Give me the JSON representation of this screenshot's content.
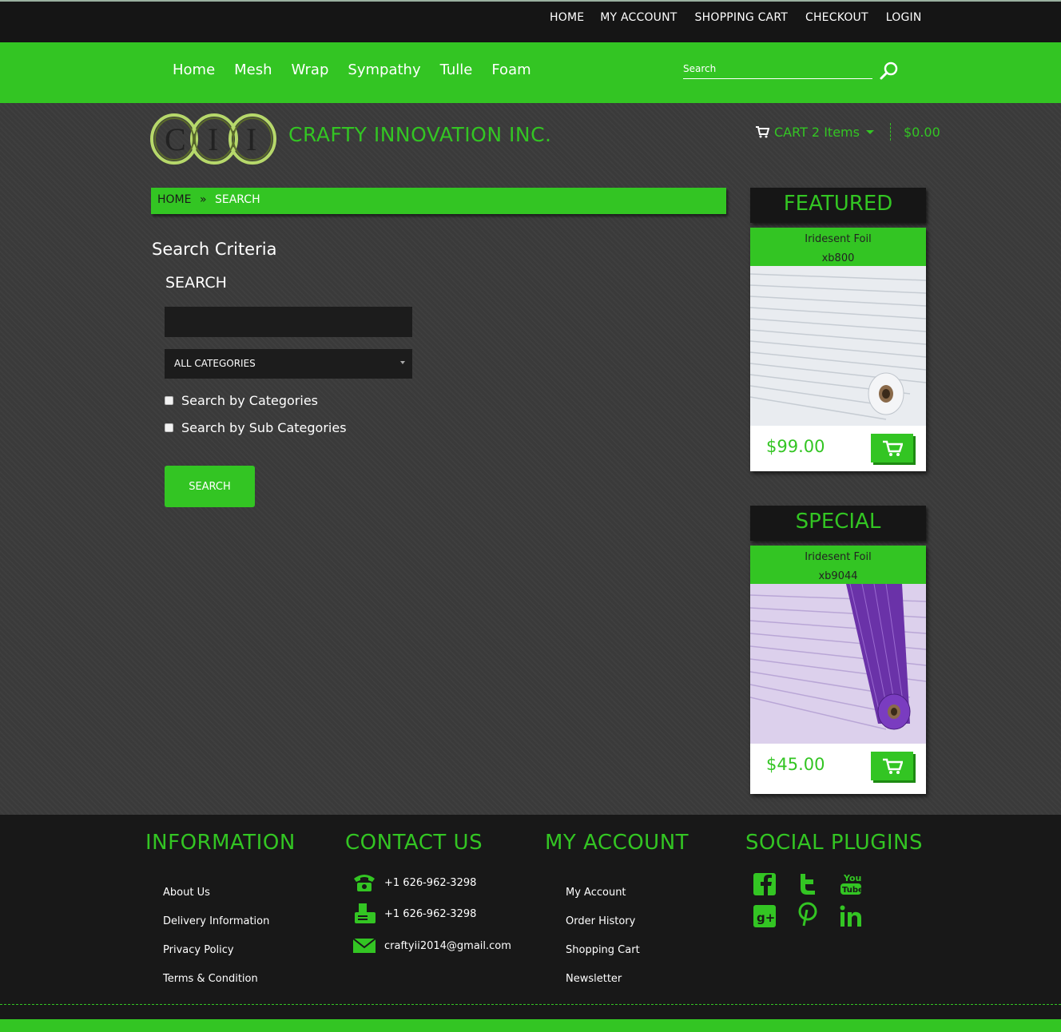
{
  "top_links": [
    "HOME",
    "MY ACCOUNT",
    "SHOPPING CART",
    "CHECKOUT",
    "LOGIN"
  ],
  "nav": [
    "Home",
    "Mesh",
    "Wrap",
    "Sympathy",
    "Tulle",
    "Foam"
  ],
  "search": {
    "placeholder": "Search"
  },
  "brand": {
    "logo_text": "CII",
    "name": "CRAFTY INNOVATION INC."
  },
  "cart": {
    "label": "CART 2 Items",
    "total": "$0.00"
  },
  "breadcrumb": {
    "home": "HOME",
    "sep": "»",
    "current": "SEARCH"
  },
  "form": {
    "criteria_title": "Search Criteria",
    "search_title": "SEARCH",
    "keyword_value": "",
    "category_selected": "ALL CATEGORIES",
    "check_categories": "Search by Categories",
    "check_subcategories": "Search by Sub Categories",
    "button": "SEARCH"
  },
  "featured": {
    "title": "FEATURED",
    "name": "Iridesent Foil",
    "sku": "xb800",
    "price": "$99.00"
  },
  "special": {
    "title": "SPECIAL",
    "name": "Iridesent Foil",
    "sku": "xb9044",
    "price": "$45.00"
  },
  "footer": {
    "information": {
      "title": "INFORMATION",
      "links": [
        "About Us",
        "Delivery Information",
        "Privacy Policy",
        "Terms & Condition"
      ]
    },
    "contact": {
      "title": "CONTACT US",
      "phone": "+1 626-962-3298",
      "fax": "+1 626-962-3298",
      "email": "craftyii2014@gmail.com"
    },
    "account": {
      "title": "MY ACCOUNT",
      "links": [
        "My Account",
        "Order History",
        "Shopping Cart",
        "Newsletter"
      ]
    },
    "social": {
      "title": "SOCIAL PLUGINS",
      "youtube_text_1": "You",
      "youtube_text_2": "Tube"
    }
  },
  "colors": {
    "accent": "#33c523",
    "dark": "#151515",
    "background": "#3a3a3a"
  }
}
